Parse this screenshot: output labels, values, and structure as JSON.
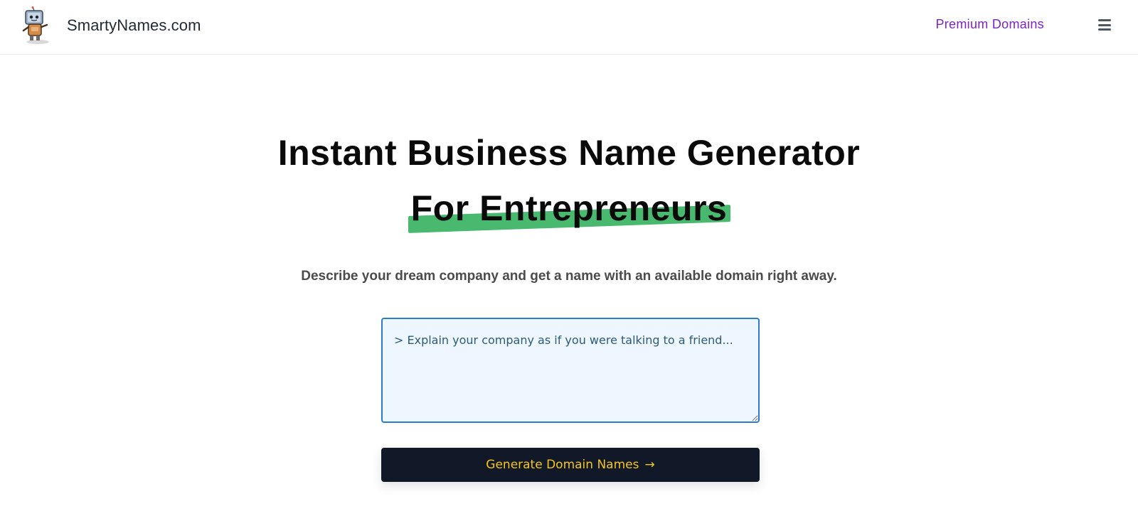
{
  "header": {
    "brand_name": "SmartyNames.com",
    "logo_icon": "robot-mascot-icon",
    "nav_link_label": "Premium Domains",
    "menu_icon": "hamburger-menu-icon"
  },
  "hero": {
    "title_line1": "Instant Business Name Generator",
    "title_line2": "For Entrepreneurs",
    "subtitle": "Describe your dream company and get a name with an available domain right away."
  },
  "form": {
    "prompt_placeholder": "> Explain your company as if you were talking to a friend...",
    "prompt_value": "",
    "generate_button_label": "Generate Domain Names",
    "generate_button_arrow": "→"
  },
  "colors": {
    "accent_link": "#7e22ce",
    "highlight_green": "#49b96f",
    "button_bg": "#111827",
    "button_text": "#f5c518",
    "input_border": "#2b7bd0",
    "input_bg": "#eef6ff"
  }
}
